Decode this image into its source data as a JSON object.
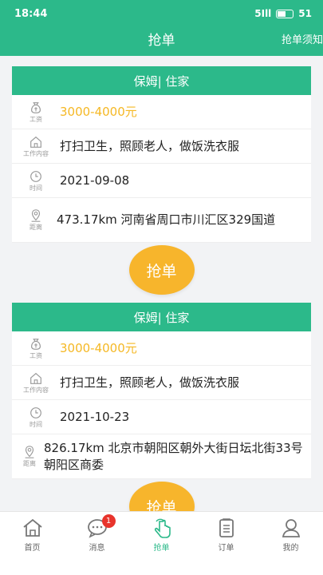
{
  "status_bar": {
    "time": "18:44",
    "signal_text": "5Ill",
    "battery": "51"
  },
  "nav": {
    "title": "抢单",
    "right_link": "抢单须知"
  },
  "labels": {
    "salary": "工资",
    "work": "工作内容",
    "time": "时间",
    "distance": "距离"
  },
  "orders": [
    {
      "title": "保姆| 住家",
      "salary": "3000-4000元",
      "work": "打扫卫生，照顾老人，做饭洗衣服",
      "date": "2021-09-08",
      "distance": "473.17km 河南省周口市川汇区329国道",
      "button": "抢单"
    },
    {
      "title": "保姆| 住家",
      "salary": "3000-4000元",
      "work": "打扫卫生，照顾老人，做饭洗衣服",
      "date": "2021-10-23",
      "distance": "826.17km 北京市朝阳区朝外大街日坛北街33号朝阳区商委",
      "button": "抢单"
    }
  ],
  "tabbar": {
    "items": [
      {
        "label": "首页",
        "icon": "home-icon"
      },
      {
        "label": "消息",
        "icon": "message-icon",
        "badge": "1"
      },
      {
        "label": "抢单",
        "icon": "grab-hand-icon",
        "active": true
      },
      {
        "label": "订单",
        "icon": "order-list-icon"
      },
      {
        "label": "我的",
        "icon": "profile-icon"
      }
    ]
  },
  "colors": {
    "brand": "#2cb98a",
    "accent": "#f7b52c",
    "salary": "#f5b824",
    "badge": "#e8342c"
  }
}
